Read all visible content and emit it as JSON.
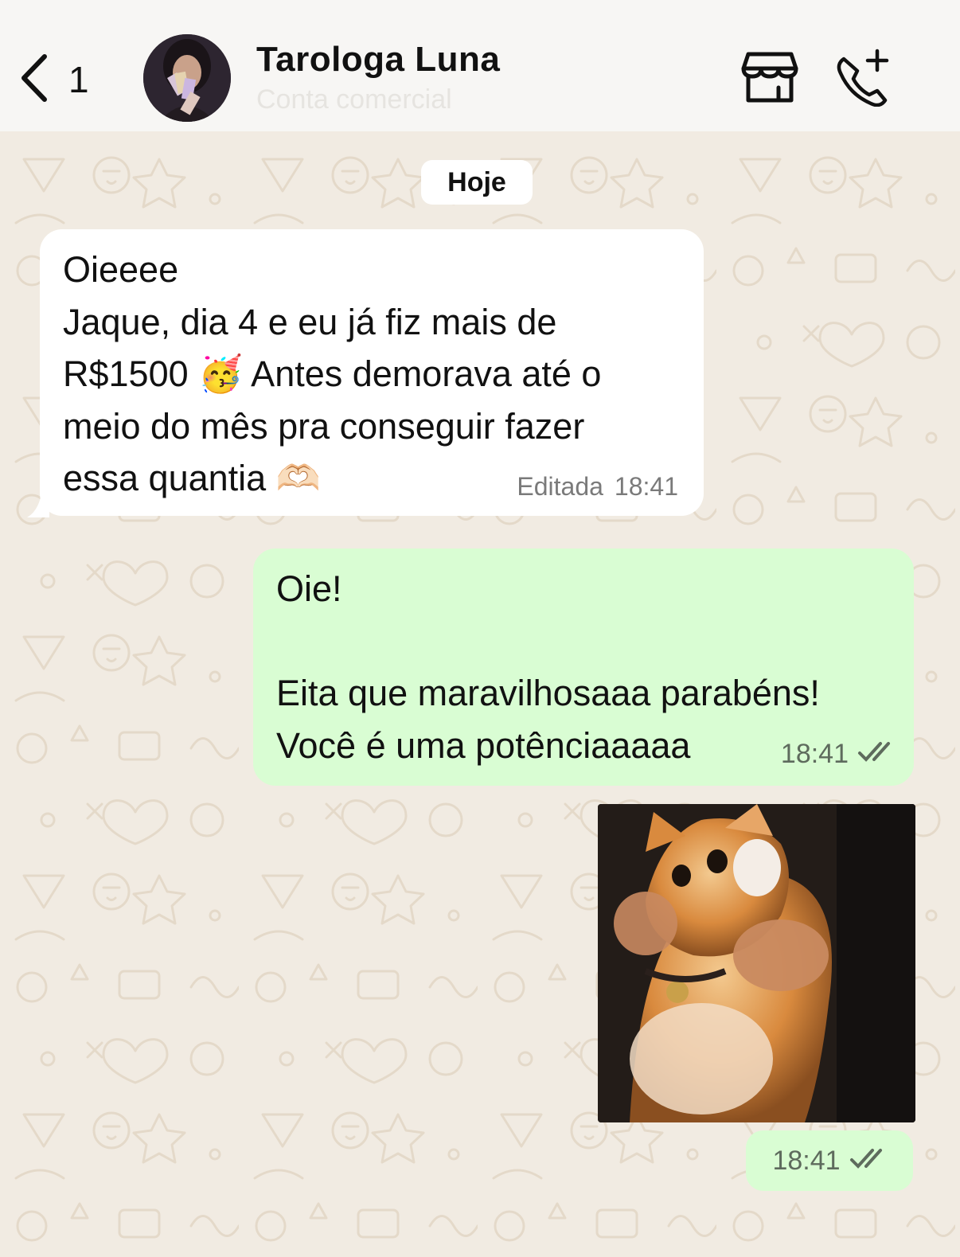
{
  "header": {
    "back_count": "1",
    "contact_name": "Tarologa Luna",
    "contact_subtitle": "Conta comercial"
  },
  "date_separator": "Hoje",
  "messages": [
    {
      "direction": "incoming",
      "lines": [
        "Oieeee",
        "Jaque, dia 4 e eu já fiz mais de",
        "R$1500 🥳 Antes demorava até o",
        "meio do mês pra conseguir fazer",
        "essa quantia 🫶🏻"
      ],
      "edited_label": "Editada",
      "time": "18:41"
    },
    {
      "direction": "outgoing",
      "lines": [
        "Oie!",
        "",
        "Eita que maravilhosaaa parabéns!",
        "Você é uma potênciaaaaa"
      ],
      "time": "18:41",
      "status": "read"
    },
    {
      "direction": "outgoing",
      "type": "image",
      "image_subject": "orange cat being held by hands",
      "time": "18:41",
      "status": "read"
    }
  ],
  "colors": {
    "header_bg": "#f7f6f4",
    "chat_bg": "#f1ebe2",
    "incoming_bubble": "#ffffff",
    "outgoing_bubble": "#d9fdd3",
    "ticks": "#5e6b5d"
  },
  "icons": [
    "chevron-left-icon",
    "store-icon",
    "phone-add-icon",
    "double-check-icon"
  ]
}
